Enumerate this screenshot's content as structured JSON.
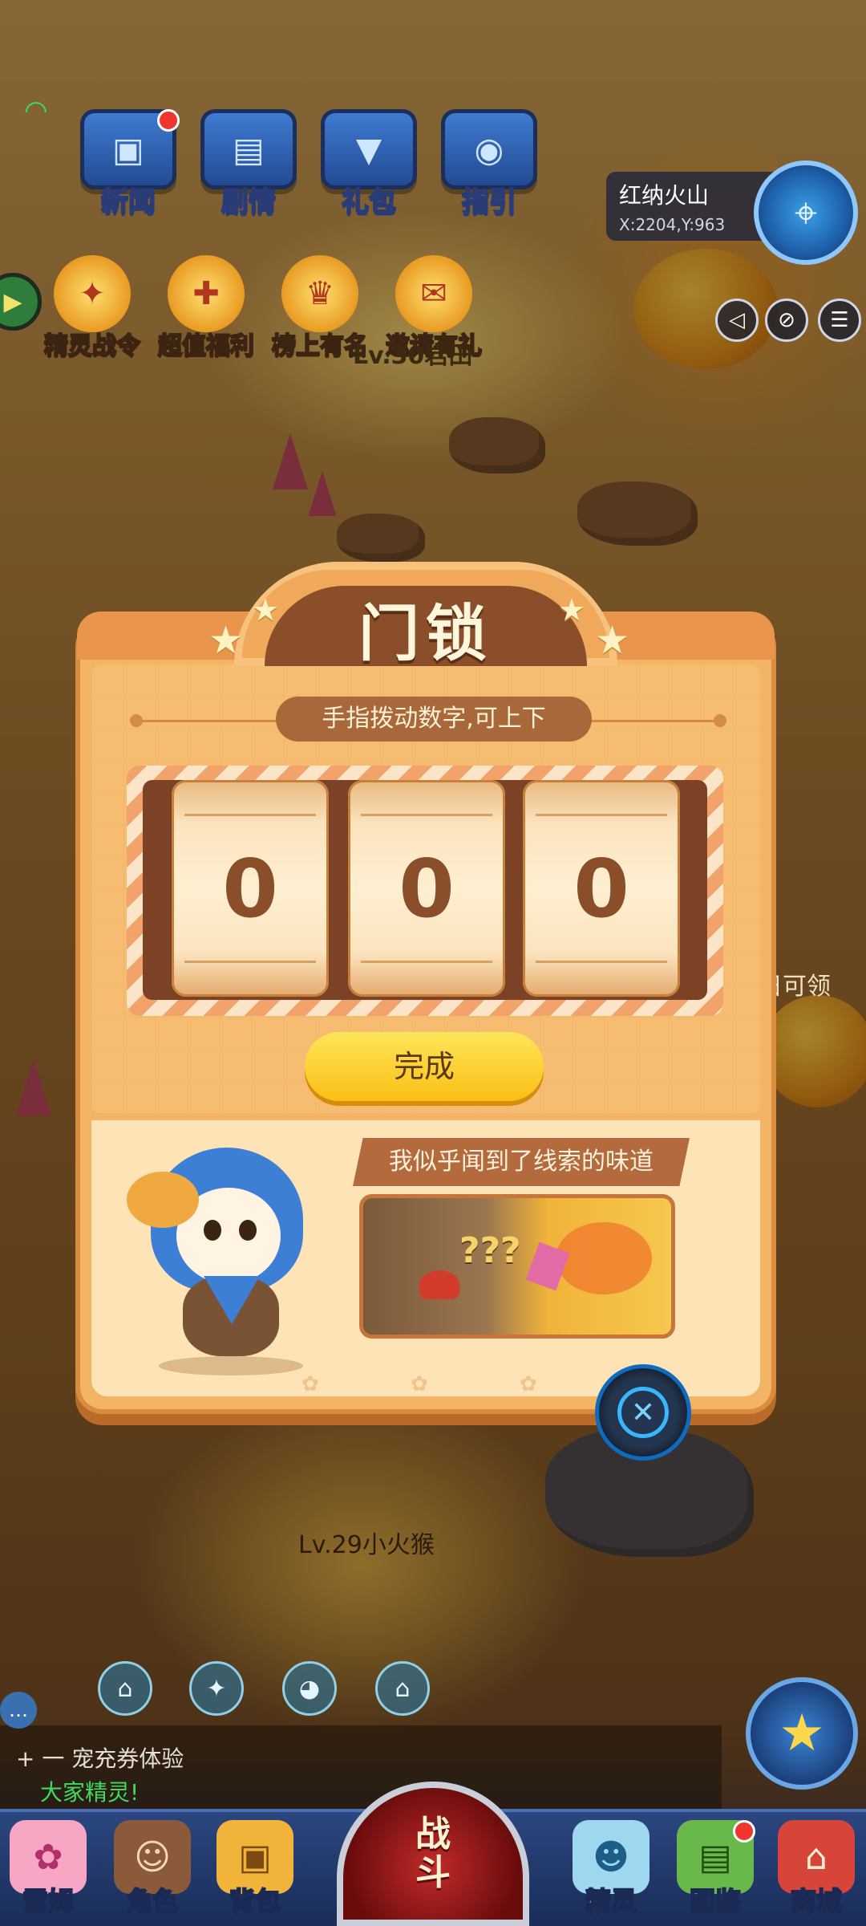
{
  "hud": {
    "top_buttons": [
      {
        "label": "新闻",
        "icon": "tv-icon",
        "badge": true
      },
      {
        "label": "剧情",
        "icon": "book-icon",
        "badge": false
      },
      {
        "label": "礼包",
        "icon": "gift-chest-icon",
        "badge": false
      },
      {
        "label": "指引",
        "icon": "guide-icon",
        "badge": false
      }
    ],
    "promos": [
      {
        "label": "精灵战令",
        "icon": "pass-icon"
      },
      {
        "label": "超值福利",
        "icon": "gift-icon"
      },
      {
        "label": "榜上有名",
        "icon": "trophy-icon"
      },
      {
        "label": "邀请有礼",
        "icon": "invite-icon"
      }
    ],
    "location_name": "红纳火山",
    "location_coord": "X:2204,Y:963",
    "npc_tag_top": "Lv.30岩田",
    "side_tag": "日可领"
  },
  "modal": {
    "title": "门锁",
    "hint": "手指拨动数字,可上下",
    "digits": [
      "0",
      "0",
      "0"
    ],
    "confirm_label": "完成",
    "clue_text": "我似乎闻到了线索的味道",
    "clue_marks": "???"
  },
  "scene": {
    "lv_label": "Lv.29小火猴"
  },
  "chat": {
    "line1": "+ 一  宠充券体验",
    "line2": "大家精灵!"
  },
  "nav": {
    "items": [
      {
        "label": "雷姆",
        "icon": "pet-avatar-icon"
      },
      {
        "label": "角色",
        "icon": "hero-avatar-icon"
      },
      {
        "label": "背包",
        "icon": "backpack-icon"
      },
      {
        "label": "精灵",
        "icon": "spirit-icon"
      },
      {
        "label": "图鉴",
        "icon": "codex-icon",
        "badge": true
      },
      {
        "label": "商城",
        "icon": "shop-icon"
      }
    ],
    "battle_line1": "战",
    "battle_line2": "斗"
  },
  "colors": {
    "panel": "#f3b565",
    "title_bg": "#8a4e2b",
    "confirm": "#fbbf15",
    "nav_bg": "#1a2d58"
  }
}
